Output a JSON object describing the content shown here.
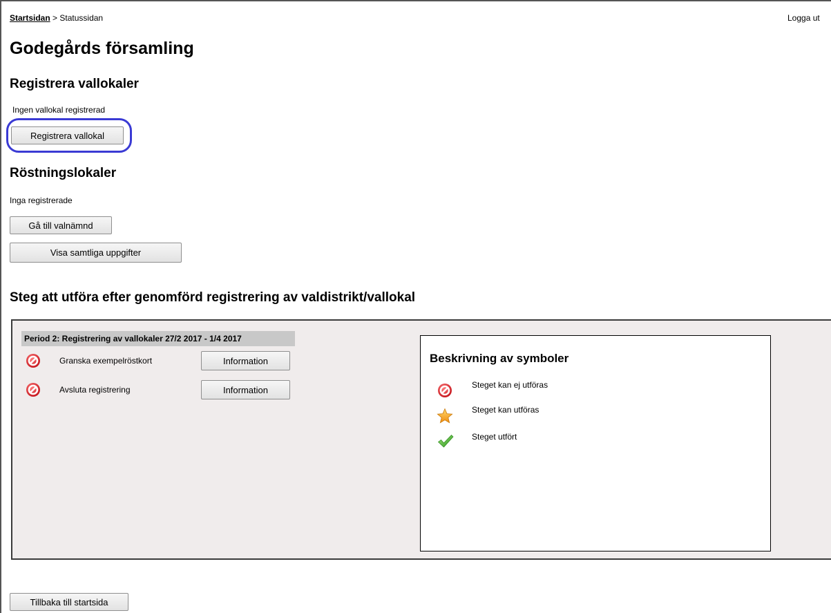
{
  "breadcrumb": {
    "home": "Startsidan",
    "separator": ">",
    "current": "Statussidan"
  },
  "header": {
    "logout": "Logga ut"
  },
  "page_title": "Godegårds församling",
  "register_section": {
    "heading": "Registrera vallokaler",
    "status_text": "Ingen vallokal registrerad",
    "button_label": "Registrera vallokal",
    "highlight_color": "#3a3ad4"
  },
  "polling_section": {
    "heading": "Röstningslokaler",
    "status_text": "Inga registrerade",
    "goto_button": "Gå till valnämnd",
    "show_all_button": "Visa samtliga uppgifter"
  },
  "steps_section": {
    "heading": "Steg att utföra efter genomförd registrering av valdistrikt/vallokal",
    "period_title": "Period 2: Registrering av vallokaler 27/2 2017 - 1/4 2017",
    "steps": [
      {
        "icon": "forbidden-icon",
        "label": "Granska exempelröstkort",
        "button": "Information"
      },
      {
        "icon": "forbidden-icon",
        "label": "Avsluta registrering",
        "button": "Information"
      }
    ]
  },
  "legend": {
    "title": "Beskrivning av symboler",
    "items": [
      {
        "icon": "forbidden-icon",
        "label": "Steget kan ej utföras"
      },
      {
        "icon": "star-icon",
        "label": "Steget kan utföras"
      },
      {
        "icon": "checkmark-icon",
        "label": "Steget utfört"
      }
    ]
  },
  "footer": {
    "back_button": "Tillbaka till startsida"
  },
  "colors": {
    "panel_background": "#f0ecec",
    "period_header_background": "#c8c8c8",
    "forbidden": "#d9232b",
    "star": "#f5a623",
    "check": "#56b530"
  }
}
